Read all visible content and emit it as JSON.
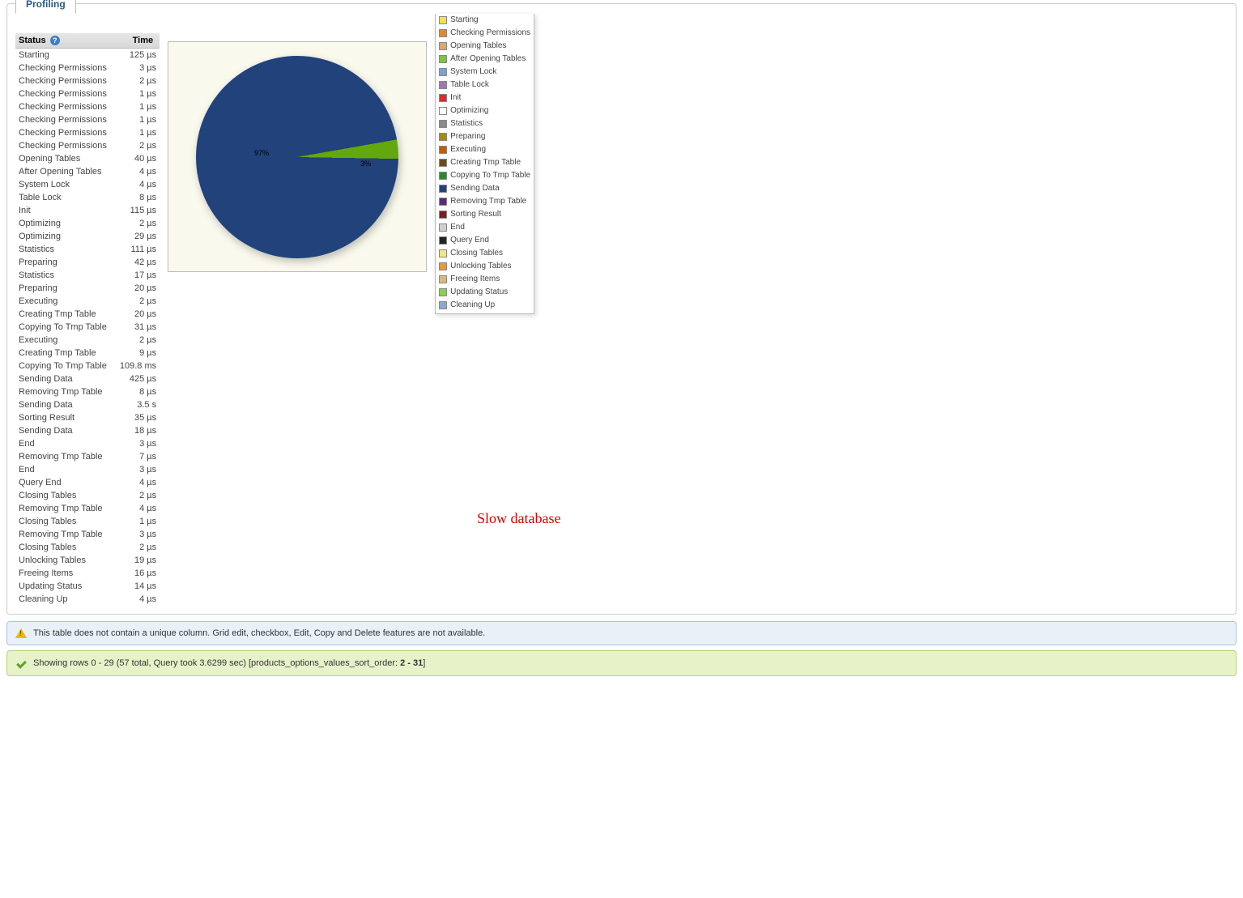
{
  "tab": {
    "label": "Profiling"
  },
  "table": {
    "headers": {
      "status": "Status",
      "time": "Time"
    },
    "rows": [
      {
        "status": "Starting",
        "time": "125 µs"
      },
      {
        "status": "Checking Permissions",
        "time": "3 µs"
      },
      {
        "status": "Checking Permissions",
        "time": "2 µs"
      },
      {
        "status": "Checking Permissions",
        "time": "1 µs"
      },
      {
        "status": "Checking Permissions",
        "time": "1 µs"
      },
      {
        "status": "Checking Permissions",
        "time": "1 µs"
      },
      {
        "status": "Checking Permissions",
        "time": "1 µs"
      },
      {
        "status": "Checking Permissions",
        "time": "2 µs"
      },
      {
        "status": "Opening Tables",
        "time": "40 µs"
      },
      {
        "status": "After Opening Tables",
        "time": "4 µs"
      },
      {
        "status": "System Lock",
        "time": "4 µs"
      },
      {
        "status": "Table Lock",
        "time": "8 µs"
      },
      {
        "status": "Init",
        "time": "115 µs"
      },
      {
        "status": "Optimizing",
        "time": "2 µs"
      },
      {
        "status": "Optimizing",
        "time": "29 µs"
      },
      {
        "status": "Statistics",
        "time": "111 µs"
      },
      {
        "status": "Preparing",
        "time": "42 µs"
      },
      {
        "status": "Statistics",
        "time": "17 µs"
      },
      {
        "status": "Preparing",
        "time": "20 µs"
      },
      {
        "status": "Executing",
        "time": "2 µs"
      },
      {
        "status": "Creating Tmp Table",
        "time": "20 µs"
      },
      {
        "status": "Copying To Tmp Table",
        "time": "31 µs"
      },
      {
        "status": "Executing",
        "time": "2 µs"
      },
      {
        "status": "Creating Tmp Table",
        "time": "9 µs"
      },
      {
        "status": "Copying To Tmp Table",
        "time": "109.8 ms"
      },
      {
        "status": "Sending Data",
        "time": "425 µs"
      },
      {
        "status": "Removing Tmp Table",
        "time": "8 µs"
      },
      {
        "status": "Sending Data",
        "time": "3.5 s"
      },
      {
        "status": "Sorting Result",
        "time": "35 µs"
      },
      {
        "status": "Sending Data",
        "time": "18 µs"
      },
      {
        "status": "End",
        "time": "3 µs"
      },
      {
        "status": "Removing Tmp Table",
        "time": "7 µs"
      },
      {
        "status": "End",
        "time": "3 µs"
      },
      {
        "status": "Query End",
        "time": "4 µs"
      },
      {
        "status": "Closing Tables",
        "time": "2 µs"
      },
      {
        "status": "Removing Tmp Table",
        "time": "4 µs"
      },
      {
        "status": "Closing Tables",
        "time": "1 µs"
      },
      {
        "status": "Removing Tmp Table",
        "time": "3 µs"
      },
      {
        "status": "Closing Tables",
        "time": "2 µs"
      },
      {
        "status": "Unlocking Tables",
        "time": "19 µs"
      },
      {
        "status": "Freeing Items",
        "time": "16 µs"
      },
      {
        "status": "Updating Status",
        "time": "14 µs"
      },
      {
        "status": "Cleaning Up",
        "time": "4 µs"
      }
    ]
  },
  "chart_data": {
    "type": "pie",
    "title": "",
    "slices": [
      {
        "label": "Sending Data",
        "percent": 97,
        "color": "#21427a"
      },
      {
        "label": "Copying To Tmp Table",
        "percent": 3,
        "color": "#63a80c"
      }
    ],
    "big_label": "97%",
    "small_label": "3%"
  },
  "legend": [
    {
      "label": "Starting",
      "color": "#f4e04d"
    },
    {
      "label": "Checking Permissions",
      "color": "#e08a2c"
    },
    {
      "label": "Opening Tables",
      "color": "#d9a86c"
    },
    {
      "label": "After Opening Tables",
      "color": "#7cc342"
    },
    {
      "label": "System Lock",
      "color": "#7ba0d9"
    },
    {
      "label": "Table Lock",
      "color": "#a076b5"
    },
    {
      "label": "Init",
      "color": "#d32f2f"
    },
    {
      "label": "Optimizing",
      "color": "#ffffff"
    },
    {
      "label": "Statistics",
      "color": "#8a8a8a"
    },
    {
      "label": "Preparing",
      "color": "#a38f00"
    },
    {
      "label": "Executing",
      "color": "#c25b0f"
    },
    {
      "label": "Creating Tmp Table",
      "color": "#6a4a1f"
    },
    {
      "label": "Copying To Tmp Table",
      "color": "#2a8a2a"
    },
    {
      "label": "Sending Data",
      "color": "#21427a"
    },
    {
      "label": "Removing Tmp Table",
      "color": "#5a2a7a"
    },
    {
      "label": "Sorting Result",
      "color": "#7a1f1f"
    },
    {
      "label": "End",
      "color": "#d0d0d0"
    },
    {
      "label": "Query End",
      "color": "#222222"
    },
    {
      "label": "Closing Tables",
      "color": "#f0e68c"
    },
    {
      "label": "Unlocking Tables",
      "color": "#e69a3c"
    },
    {
      "label": "Freeing Items",
      "color": "#d9b77c"
    },
    {
      "label": "Updating Status",
      "color": "#8ccf4a"
    },
    {
      "label": "Cleaning Up",
      "color": "#8aa8d4"
    }
  ],
  "annotation": "Slow database",
  "notice_info": "This table does not contain a unique column. Grid edit, checkbox, Edit, Copy and Delete features are not available.",
  "notice_success": {
    "prefix": "Showing rows 0 - 29 (57 total, Query took 3.6299 sec) [products_options_values_sort_order: ",
    "bold": "2 - 31",
    "suffix": "]"
  }
}
